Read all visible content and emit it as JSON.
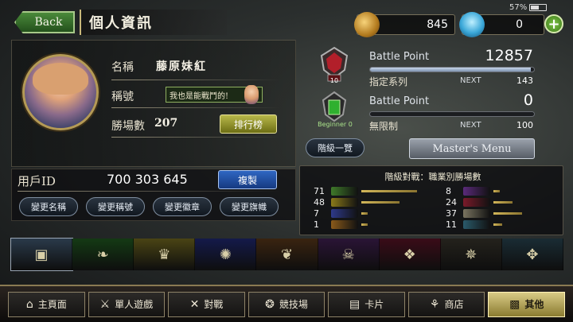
{
  "status": {
    "battery": "57%",
    "battery_level": 0.57
  },
  "header": {
    "back_label": "Back",
    "title": "個人資訊"
  },
  "currency": {
    "gold": "845",
    "crystal": "0",
    "add_icon": "plus-icon"
  },
  "profile": {
    "name_label": "名稱",
    "name_value": "藤原妹紅",
    "title_label": "稱號",
    "title_value": "我也是能戰鬥的!",
    "wins_label": "勝場數",
    "wins_value": "207",
    "ranking_button": "排行榜"
  },
  "battle_points": [
    {
      "label": "Battle Point",
      "value": "12857",
      "category": "指定系列",
      "next_label": "NEXT",
      "next_value": "143",
      "progress": 0.98,
      "emblem": "rank-crest-icon",
      "emblem_text": "10"
    },
    {
      "label": "Battle Point",
      "value": "0",
      "category": "無限制",
      "next_label": "NEXT",
      "next_value": "100",
      "progress": 0.0,
      "emblem": "beginner-crest-icon",
      "emblem_text": "Beginner 0"
    }
  ],
  "buttons": {
    "grade_list": "階級一覽",
    "master_menu": "Master's Menu",
    "copy": "複製"
  },
  "user_id": {
    "label": "用戶ID",
    "value": "700 303 645"
  },
  "change_buttons": [
    "變更名稱",
    "變更稱號",
    "變更徽章",
    "變更旗幟"
  ],
  "class_wins": {
    "title": "階級對戰：職業別勝場數",
    "left": [
      {
        "count": "71",
        "icon": "forestcraft-icon",
        "color": "#3f7a2a",
        "ratio": 1.0
      },
      {
        "count": "48",
        "icon": "swordcraft-icon",
        "color": "#8a7a1a",
        "ratio": 0.68
      },
      {
        "count": "7",
        "icon": "runecraft-icon",
        "color": "#2e3a8a",
        "ratio": 0.1
      },
      {
        "count": "1",
        "icon": "dragoncraft-icon",
        "color": "#8a5a1a",
        "ratio": 0.02
      }
    ],
    "right": [
      {
        "count": "8",
        "icon": "shadowcraft-icon",
        "color": "#5a2a7a",
        "ratio": 0.11
      },
      {
        "count": "24",
        "icon": "bloodcraft-icon",
        "color": "#7a1a2a",
        "ratio": 0.34
      },
      {
        "count": "37",
        "icon": "havencraft-icon",
        "color": "#7a7460",
        "ratio": 0.52
      },
      {
        "count": "11",
        "icon": "portalcraft-icon",
        "color": "#2a5a6a",
        "ratio": 0.15
      }
    ]
  },
  "class_tabs": [
    {
      "icon": "card-icon",
      "glyph": "▣",
      "color": "#2a3a4a"
    },
    {
      "icon": "leaf-icon",
      "glyph": "❧",
      "color": "#143a14"
    },
    {
      "icon": "crown-icon",
      "glyph": "♛",
      "color": "#4a4414"
    },
    {
      "icon": "rune-icon",
      "glyph": "✺",
      "color": "#141a4a"
    },
    {
      "icon": "dragon-icon",
      "glyph": "❦",
      "color": "#3a2410"
    },
    {
      "icon": "skull-icon",
      "glyph": "☠",
      "color": "#2a1436"
    },
    {
      "icon": "bat-icon",
      "glyph": "❖",
      "color": "#3a0c18"
    },
    {
      "icon": "wing-icon",
      "glyph": "✵",
      "color": "#24221c"
    },
    {
      "icon": "portal-icon",
      "glyph": "✥",
      "color": "#1a2c34"
    }
  ],
  "bottom_nav": [
    {
      "label": "主頁面",
      "icon": "home-icon",
      "glyph": "⌂"
    },
    {
      "label": "單人遊戲",
      "icon": "sword-icon",
      "glyph": "⚔"
    },
    {
      "label": "對戰",
      "icon": "crossed-swords-icon",
      "glyph": "✕"
    },
    {
      "label": "競技場",
      "icon": "arena-icon",
      "glyph": "❂"
    },
    {
      "label": "卡片",
      "icon": "cards-icon",
      "glyph": "▤"
    },
    {
      "label": "商店",
      "icon": "shop-icon",
      "glyph": "⚘"
    },
    {
      "label": "其他",
      "icon": "other-icon",
      "glyph": "▩",
      "active": true
    }
  ]
}
